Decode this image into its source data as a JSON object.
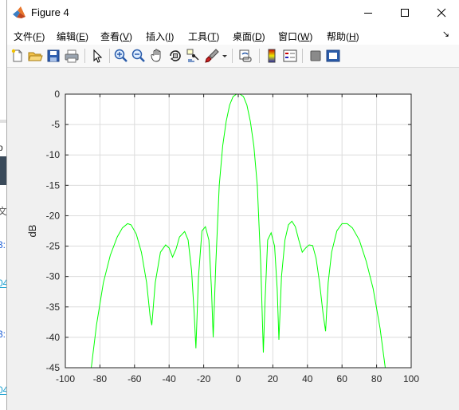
{
  "window": {
    "title": "Figure 4",
    "controls": {
      "minimize": "minimize",
      "maximize": "maximize",
      "close": "close"
    }
  },
  "menu": [
    {
      "label": "文件(",
      "key": "F",
      "tail": ")"
    },
    {
      "label": "编辑(",
      "key": "E",
      "tail": ")"
    },
    {
      "label": "查看(",
      "key": "V",
      "tail": ")"
    },
    {
      "label": "插入(",
      "key": "I",
      "tail": ")"
    },
    {
      "label": "工具(",
      "key": "T",
      "tail": ")"
    },
    {
      "label": "桌面(",
      "key": "D",
      "tail": ")"
    },
    {
      "label": "窗口(",
      "key": "W",
      "tail": ")"
    },
    {
      "label": "帮助(",
      "key": "H",
      "tail": ")"
    }
  ],
  "menu_overflow_glyph": "↘",
  "toolbar": [
    "new-figure-icon",
    "open-file-icon",
    "save-icon",
    "print-icon",
    "select-arrow-icon",
    "zoom-in-icon",
    "zoom-out-icon",
    "pan-hand-icon",
    "rotate-3d-icon",
    "data-cursor-icon",
    "brush-icon",
    "brush-dropdown-icon",
    "link-plot-icon",
    "colorbar-icon",
    "legend-icon",
    "hide-plot-tools-icon",
    "show-plot-tools-icon"
  ],
  "background_glyphs": [
    "p",
    "文",
    "3:",
    "04",
    "3:",
    "04"
  ],
  "chart_data": {
    "type": "line",
    "title": "",
    "xlabel": "",
    "ylabel": "dB",
    "xlim": [
      -100,
      100
    ],
    "ylim": [
      -45,
      0
    ],
    "xticks": [
      "-100",
      "-80",
      "-60",
      "-40",
      "-20",
      "0",
      "20",
      "40",
      "60",
      "80",
      "100"
    ],
    "yticks": [
      "0",
      "-5",
      "-10",
      "-15",
      "-20",
      "-25",
      "-30",
      "-35",
      "-40",
      "-45"
    ],
    "grid": true,
    "line_color": "#00ff00",
    "series": [
      {
        "x": [
          -85,
          -82,
          -78,
          -74,
          -70,
          -67,
          -64,
          -62,
          -59,
          -56,
          -53,
          -51,
          -50,
          -48,
          -45,
          -42,
          -40,
          -38,
          -36,
          -34,
          -31,
          -29,
          -27,
          -25.5,
          -24.5,
          -23,
          -21,
          -19,
          -17,
          -15.5,
          -14.5,
          -13,
          -11,
          -9,
          -7,
          -5,
          -3,
          -1,
          0,
          1,
          3,
          5,
          7,
          9,
          11,
          13,
          14.5,
          15.5,
          17,
          19,
          21,
          22.5,
          23.5,
          25,
          27,
          29,
          31,
          33,
          35,
          37,
          39,
          41,
          43,
          45,
          47,
          49,
          50.5,
          52,
          54,
          57,
          60,
          63,
          66,
          70,
          74,
          78,
          82,
          85
        ],
        "y": [
          -45,
          -38,
          -31,
          -26.5,
          -23.5,
          -22,
          -21.3,
          -21.5,
          -23,
          -26,
          -31,
          -36.5,
          -38,
          -31,
          -26,
          -24.8,
          -25.3,
          -26.8,
          -25.5,
          -23.5,
          -22.6,
          -24,
          -29,
          -36,
          -41.8,
          -30,
          -22.5,
          -21.8,
          -24,
          -32,
          -40,
          -28,
          -15,
          -8.5,
          -4.5,
          -1.8,
          -0.4,
          0,
          0,
          0,
          -0.4,
          -1.8,
          -4.5,
          -8.5,
          -15,
          -28,
          -42.5,
          -34,
          -24,
          -22.8,
          -25,
          -32,
          -40.4,
          -30,
          -24,
          -21.5,
          -20.9,
          -21.8,
          -24,
          -26,
          -25.3,
          -24.8,
          -24.9,
          -27,
          -31,
          -36,
          -39,
          -31,
          -26,
          -22.5,
          -21.3,
          -21.3,
          -22,
          -24,
          -27.5,
          -32,
          -38.5,
          -45
        ]
      }
    ]
  }
}
